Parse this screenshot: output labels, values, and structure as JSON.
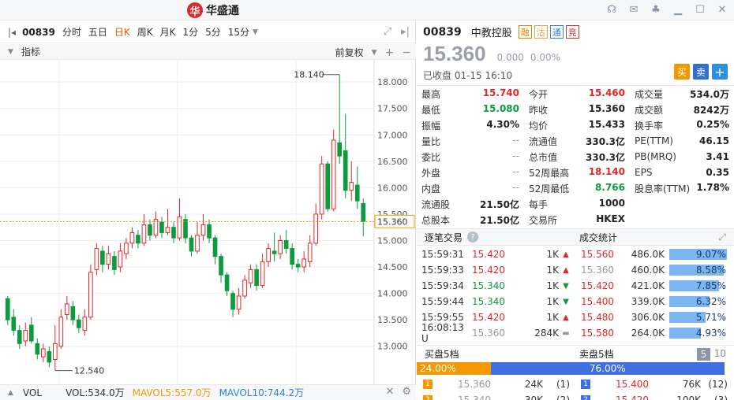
{
  "app": {
    "logo_text": "华盛通",
    "window_icons": [
      "headset-icon",
      "mail-icon",
      "shirt-icon",
      "minimize-icon",
      "maximize-icon",
      "close-icon"
    ]
  },
  "toolbar": {
    "code": "00839",
    "periods": [
      "分时",
      "五日",
      "日K",
      "周K",
      "月K",
      "1分",
      "5分",
      "15分"
    ],
    "active_period": "日K"
  },
  "indicator_bar": {
    "label": "指标",
    "adjust": "前复权"
  },
  "volume_bar": {
    "label": "VOL",
    "vol": "VOL:534.0万",
    "mavol5": "MAVOL5:557.0万",
    "mavol10": "MAVOL10:744.2万"
  },
  "colors": {
    "up": "#e02828",
    "down": "#0d9b3e",
    "accent": "#f39800",
    "blue": "#3f6fe0"
  },
  "chart_data": {
    "type": "candlestick",
    "y_ticks": [
      "18.000",
      "17.500",
      "17.000",
      "16.500",
      "16.000",
      "15.500",
      "15.000",
      "14.500",
      "14.000",
      "13.500",
      "13.000"
    ],
    "ylim": [
      12.4,
      18.3
    ],
    "current_price_label": "15.360",
    "current_price": 15.36,
    "high_label": "18.140",
    "high_value": 18.14,
    "low_label": "12.540",
    "low_value": 12.54,
    "candles": [
      {
        "o": 13.9,
        "c": 13.5,
        "h": 13.95,
        "l": 13.4
      },
      {
        "o": 13.55,
        "c": 13.3,
        "h": 13.7,
        "l": 13.2
      },
      {
        "o": 13.3,
        "c": 13.05,
        "h": 13.4,
        "l": 12.95
      },
      {
        "o": 13.1,
        "c": 13.3,
        "h": 13.45,
        "l": 13.0
      },
      {
        "o": 13.4,
        "c": 13.1,
        "h": 13.55,
        "l": 13.05
      },
      {
        "o": 13.05,
        "c": 12.85,
        "h": 13.15,
        "l": 12.75
      },
      {
        "o": 12.8,
        "c": 12.95,
        "h": 13.05,
        "l": 12.7
      },
      {
        "o": 12.9,
        "c": 12.7,
        "h": 13.0,
        "l": 12.6
      },
      {
        "o": 12.75,
        "c": 13.05,
        "h": 13.4,
        "l": 12.54
      },
      {
        "o": 13.0,
        "c": 13.55,
        "h": 13.7,
        "l": 12.95
      },
      {
        "o": 13.6,
        "c": 13.8,
        "h": 13.95,
        "l": 13.5
      },
      {
        "o": 13.75,
        "c": 13.5,
        "h": 13.85,
        "l": 13.4
      },
      {
        "o": 13.5,
        "c": 13.35,
        "h": 13.6,
        "l": 13.25
      },
      {
        "o": 13.3,
        "c": 13.55,
        "h": 13.7,
        "l": 13.2
      },
      {
        "o": 13.55,
        "c": 14.4,
        "h": 14.55,
        "l": 13.5
      },
      {
        "o": 14.45,
        "c": 14.85,
        "h": 14.95,
        "l": 14.35
      },
      {
        "o": 14.8,
        "c": 14.55,
        "h": 14.9,
        "l": 14.4
      },
      {
        "o": 14.55,
        "c": 14.75,
        "h": 14.9,
        "l": 14.45
      },
      {
        "o": 14.7,
        "c": 14.45,
        "h": 14.8,
        "l": 14.35
      },
      {
        "o": 14.5,
        "c": 14.8,
        "h": 14.95,
        "l": 14.4
      },
      {
        "o": 14.75,
        "c": 14.95,
        "h": 15.05,
        "l": 14.65
      },
      {
        "o": 14.95,
        "c": 15.15,
        "h": 15.25,
        "l": 14.85
      },
      {
        "o": 15.1,
        "c": 14.95,
        "h": 15.2,
        "l": 14.85
      },
      {
        "o": 14.95,
        "c": 15.3,
        "h": 15.5,
        "l": 14.9
      },
      {
        "o": 15.3,
        "c": 15.1,
        "h": 15.4,
        "l": 15.0
      },
      {
        "o": 15.1,
        "c": 15.4,
        "h": 15.55,
        "l": 15.05
      },
      {
        "o": 15.35,
        "c": 15.15,
        "h": 15.45,
        "l": 15.05
      },
      {
        "o": 15.15,
        "c": 15.25,
        "h": 15.6,
        "l": 15.1
      },
      {
        "o": 15.25,
        "c": 15.05,
        "h": 15.35,
        "l": 14.95
      },
      {
        "o": 15.05,
        "c": 15.45,
        "h": 15.8,
        "l": 15.0
      },
      {
        "o": 15.4,
        "c": 15.05,
        "h": 15.5,
        "l": 14.95
      },
      {
        "o": 15.05,
        "c": 14.8,
        "h": 15.1,
        "l": 14.7
      },
      {
        "o": 14.8,
        "c": 15.1,
        "h": 15.35,
        "l": 14.75
      },
      {
        "o": 15.1,
        "c": 15.3,
        "h": 15.5,
        "l": 15.0
      },
      {
        "o": 15.3,
        "c": 15.05,
        "h": 15.4,
        "l": 14.95
      },
      {
        "o": 15.05,
        "c": 14.7,
        "h": 15.1,
        "l": 14.55
      },
      {
        "o": 14.7,
        "c": 14.35,
        "h": 14.75,
        "l": 14.2
      },
      {
        "o": 14.35,
        "c": 14.05,
        "h": 14.4,
        "l": 13.95
      },
      {
        "o": 14.0,
        "c": 13.7,
        "h": 14.05,
        "l": 13.55
      },
      {
        "o": 13.7,
        "c": 13.95,
        "h": 14.1,
        "l": 13.6
      },
      {
        "o": 13.95,
        "c": 14.25,
        "h": 14.35,
        "l": 13.9
      },
      {
        "o": 14.2,
        "c": 14.45,
        "h": 14.55,
        "l": 14.1
      },
      {
        "o": 14.45,
        "c": 14.15,
        "h": 14.55,
        "l": 14.05
      },
      {
        "o": 14.15,
        "c": 14.6,
        "h": 14.75,
        "l": 14.1
      },
      {
        "o": 14.6,
        "c": 14.85,
        "h": 14.95,
        "l": 14.5
      },
      {
        "o": 14.8,
        "c": 14.75,
        "h": 15.15,
        "l": 14.6
      },
      {
        "o": 14.75,
        "c": 15.0,
        "h": 15.1,
        "l": 14.65
      },
      {
        "o": 15.0,
        "c": 14.85,
        "h": 15.2,
        "l": 14.75
      },
      {
        "o": 14.85,
        "c": 14.55,
        "h": 14.95,
        "l": 14.45
      },
      {
        "o": 14.55,
        "c": 14.5,
        "h": 14.65,
        "l": 14.4
      },
      {
        "o": 14.5,
        "c": 14.65,
        "h": 14.8,
        "l": 14.4
      },
      {
        "o": 14.6,
        "c": 14.95,
        "h": 15.1,
        "l": 14.5
      },
      {
        "o": 14.95,
        "c": 15.5,
        "h": 15.7,
        "l": 14.9
      },
      {
        "o": 15.5,
        "c": 16.45,
        "h": 16.6,
        "l": 15.4
      },
      {
        "o": 16.45,
        "c": 15.6,
        "h": 16.5,
        "l": 15.55
      },
      {
        "o": 15.6,
        "c": 16.9,
        "h": 17.1,
        "l": 15.55
      },
      {
        "o": 16.85,
        "c": 16.6,
        "h": 18.14,
        "l": 16.45
      },
      {
        "o": 16.7,
        "c": 15.95,
        "h": 17.4,
        "l": 15.8
      },
      {
        "o": 15.95,
        "c": 16.1,
        "h": 16.5,
        "l": 15.75
      },
      {
        "o": 16.05,
        "c": 15.75,
        "h": 16.4,
        "l": 15.6
      },
      {
        "o": 15.7,
        "c": 15.36,
        "h": 15.8,
        "l": 15.08
      }
    ]
  },
  "quote": {
    "code": "00839",
    "name": "中教控股",
    "badges": [
      "融",
      "沽",
      "通",
      "竞"
    ],
    "price": "15.360",
    "change": "0.000",
    "change_pct": "0.00%",
    "status": "已收盘 01-15 16:10",
    "buy_label": "买",
    "sell_label": "卖",
    "add_label": "+"
  },
  "stats": [
    [
      {
        "k": "最高",
        "v": "15.740",
        "c": "red"
      },
      {
        "k": "今开",
        "v": "15.460",
        "c": "red"
      },
      {
        "k": "成交量",
        "v": "534.0万",
        "c": ""
      }
    ],
    [
      {
        "k": "最低",
        "v": "15.080",
        "c": "green"
      },
      {
        "k": "昨收",
        "v": "15.360",
        "c": ""
      },
      {
        "k": "成交额",
        "v": "8242万",
        "c": ""
      }
    ],
    [
      {
        "k": "振幅",
        "v": "4.30%",
        "c": ""
      },
      {
        "k": "均价",
        "v": "15.433",
        "c": ""
      },
      {
        "k": "换手率",
        "v": "0.25%",
        "c": ""
      }
    ],
    [
      {
        "k": "量比",
        "v": "--",
        "c": "muted"
      },
      {
        "k": "流通值",
        "v": "330.3亿",
        "c": ""
      },
      {
        "k": "PE(TTM)",
        "v": "46.15",
        "c": ""
      }
    ],
    [
      {
        "k": "委比",
        "v": "--",
        "c": "muted"
      },
      {
        "k": "总市值",
        "v": "330.3亿",
        "c": ""
      },
      {
        "k": "PB(MRQ)",
        "v": "3.41",
        "c": ""
      }
    ],
    [
      {
        "k": "外盘",
        "v": "--",
        "c": "muted"
      },
      {
        "k": "52周最高",
        "v": "18.140",
        "c": "red"
      },
      {
        "k": "EPS",
        "v": "0.35",
        "c": ""
      }
    ],
    [
      {
        "k": "内盘",
        "v": "--",
        "c": "muted"
      },
      {
        "k": "52周最低",
        "v": "8.766",
        "c": "green"
      },
      {
        "k": "股息率(TTM)",
        "v": "1.78%",
        "c": ""
      }
    ],
    [
      {
        "k": "流通股",
        "v": "21.50亿",
        "c": ""
      },
      {
        "k": "每手",
        "v": "1000",
        "c": ""
      },
      {
        "k": "",
        "v": "",
        "c": ""
      }
    ],
    [
      {
        "k": "总股本",
        "v": "21.50亿",
        "c": ""
      },
      {
        "k": "交易所",
        "v": "HKEX",
        "c": ""
      },
      {
        "k": "",
        "v": "",
        "c": ""
      }
    ]
  ],
  "sections": {
    "ticks_title": "逐笔交易",
    "ticks_help": "?",
    "dist_title": "成交统计",
    "orderbook_bid_title": "买盘5档",
    "orderbook_ask_title": "卖盘5档",
    "level5": "5",
    "level10": "10"
  },
  "ticks": [
    {
      "time": "15:59:31",
      "price": "15.420",
      "vol": "1K",
      "c": "red",
      "dir": "up"
    },
    {
      "time": "15:59:33",
      "price": "15.420",
      "vol": "1K",
      "c": "red",
      "dir": "up"
    },
    {
      "time": "15:59:34",
      "price": "15.340",
      "vol": "1K",
      "c": "green",
      "dir": "down"
    },
    {
      "time": "15:59:44",
      "price": "15.340",
      "vol": "1K",
      "c": "green",
      "dir": "down"
    },
    {
      "time": "15:59:55",
      "price": "15.420",
      "vol": "1K",
      "c": "red",
      "dir": "up"
    },
    {
      "time": "16:08:13 U",
      "price": "15.360",
      "vol": "284K",
      "c": "muted",
      "dir": "flat"
    }
  ],
  "volume_dist": [
    {
      "price": "15.560",
      "vol": "486.0K",
      "pct": "9.07%",
      "frac": 0.98,
      "c": "red"
    },
    {
      "price": "15.360",
      "vol": "460.0K",
      "pct": "8.58%",
      "frac": 0.93,
      "c": "muted"
    },
    {
      "price": "15.420",
      "vol": "421.0K",
      "pct": "7.85%",
      "frac": 0.85,
      "c": "red"
    },
    {
      "price": "15.400",
      "vol": "339.0K",
      "pct": "6.32%",
      "frac": 0.69,
      "c": "red"
    },
    {
      "price": "15.480",
      "vol": "306.0K",
      "pct": "5.71%",
      "frac": 0.62,
      "c": "red"
    },
    {
      "price": "15.580",
      "vol": "264.0K",
      "pct": "4.93%",
      "frac": 0.54,
      "c": "red"
    }
  ],
  "ratio": {
    "bid_pct": "24.00%",
    "ask_pct": "76.00%",
    "bid_frac": 0.24
  },
  "orderbook": [
    {
      "bid_lvl": "1",
      "bid_price": "15.360",
      "bid_vol": "24K",
      "bid_cnt": "(1)",
      "ask_lvl": "1",
      "ask_price": "15.400",
      "ask_vol": "76K",
      "ask_cnt": "(12)"
    },
    {
      "bid_lvl": "2",
      "bid_price": "15.340",
      "bid_vol": "30K",
      "bid_cnt": "(2)",
      "ask_lvl": "2",
      "ask_price": "15.420",
      "ask_vol": "100K",
      "ask_cnt": "(3)"
    }
  ]
}
